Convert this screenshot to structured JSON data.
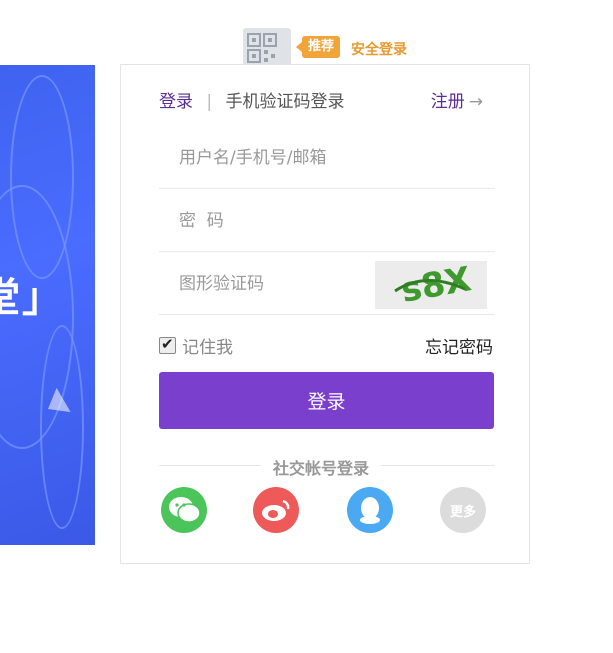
{
  "banner": {
    "text": "堂」"
  },
  "recommend": {
    "tag": "推荐",
    "text": "安全登录"
  },
  "tabs": {
    "login": "登录",
    "sep": "|",
    "sms": "手机验证码登录"
  },
  "register": {
    "label": "注册",
    "arrow": "→"
  },
  "fields": {
    "username_placeholder": "用户名/手机号/邮箱",
    "password_placeholder": "密  码",
    "captcha_placeholder": "图形验证码",
    "captcha_text": "s8X"
  },
  "remember": {
    "label": "记住我",
    "checked": true
  },
  "forgot": {
    "label": "忘记密码"
  },
  "login_button": {
    "label": "登录"
  },
  "social": {
    "title": "社交帐号登录",
    "items": [
      {
        "name": "wechat-icon"
      },
      {
        "name": "weibo-icon"
      },
      {
        "name": "qq-icon"
      },
      {
        "name": "more-icon",
        "label": "更多"
      }
    ]
  },
  "colors": {
    "accent": "#7b3fce",
    "link": "#5b2d91",
    "tag": "#f1a43a"
  }
}
